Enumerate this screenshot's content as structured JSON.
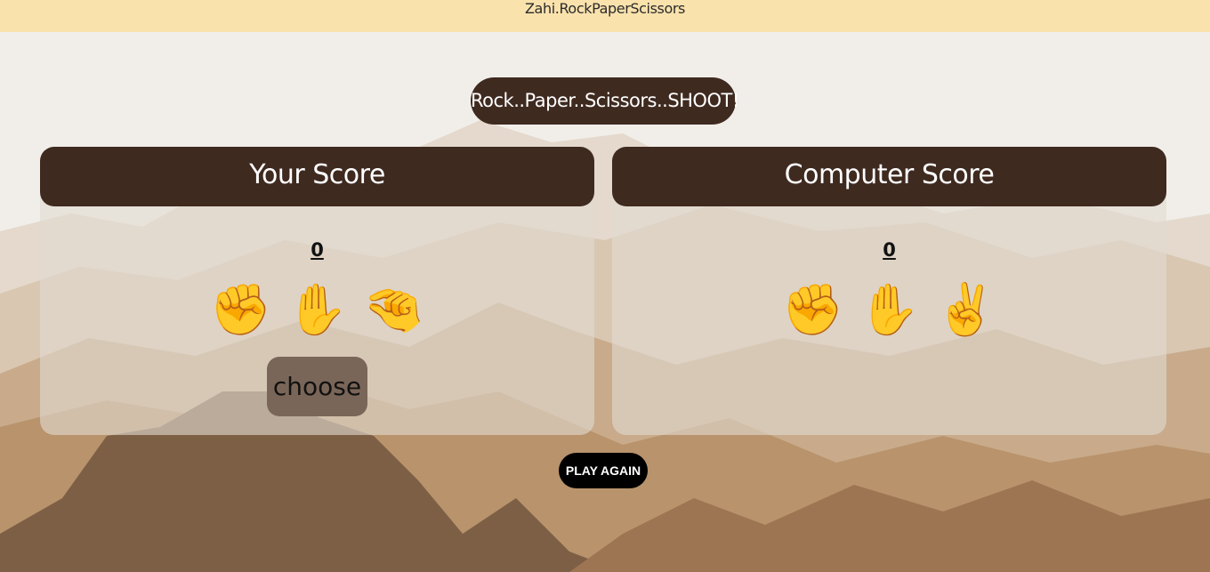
{
  "header": {
    "brand": "Zahi.RockPaperScissors"
  },
  "banner": {
    "text": "Rock..Paper..Scissors..SHOOT!"
  },
  "player": {
    "title": "Your Score",
    "score": "0",
    "hands": [
      "✊",
      "✋",
      "🤏"
    ],
    "hand_icons": [
      "rock-icon",
      "paper-icon",
      "scissors-icon"
    ],
    "choose_label": "choose"
  },
  "computer": {
    "title": "Computer Score",
    "score": "0",
    "hands": [
      "✊",
      "✋",
      "✌️"
    ],
    "hand_icons": [
      "rock-icon",
      "paper-icon",
      "scissors-icon"
    ]
  },
  "controls": {
    "play_again_label": "PLAY AGAIN"
  },
  "colors": {
    "topbar": "#fae2ad",
    "dark_brown": "#3f2a20",
    "choose_button": "#7a6658",
    "play_again": "#000000"
  }
}
